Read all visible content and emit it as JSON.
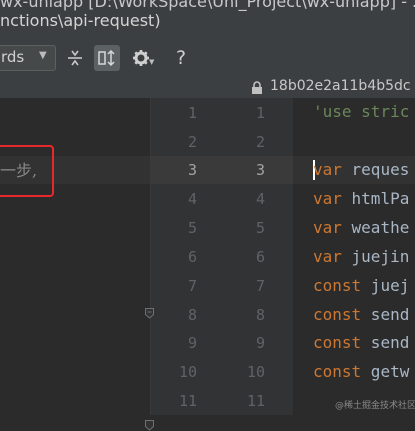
{
  "window": {
    "title_partial": "wx-uniapp [D:\\WorkSpace\\Uni_Project\\wx-uniapp] - ...\\uni",
    "path_title": "nctions\\api-request)"
  },
  "toolbar": {
    "dropdown_value": "rds",
    "buttons": [
      "collapse-unchanged",
      "side-by-side-viewer",
      "settings",
      "help"
    ],
    "help_label": "?"
  },
  "infobar": {
    "revision_hash": "18b02e2a11b4b5dc"
  },
  "left_pane": {
    "highlighted_text": "一步,"
  },
  "gutter": {
    "left_numbers": [
      "1",
      "2",
      "3",
      "4",
      "5",
      "6",
      "7",
      "8",
      "9",
      "10",
      "11"
    ],
    "right_numbers": [
      "1",
      "2",
      "3",
      "4",
      "5",
      "6",
      "7",
      "8",
      "9",
      "10",
      "11"
    ],
    "current_line": "3"
  },
  "editor": {
    "lines": [
      {
        "kw": "",
        "rest": "",
        "str": "'use stric"
      },
      {
        "kw": "",
        "rest": "",
        "str": ""
      },
      {
        "kw": "var",
        "rest": " reques",
        "str": ""
      },
      {
        "kw": "var",
        "rest": " htmlPa",
        "str": ""
      },
      {
        "kw": "var",
        "rest": " weathe",
        "str": ""
      },
      {
        "kw": "var",
        "rest": " juejin",
        "str": ""
      },
      {
        "kw": "const",
        "rest": " juej",
        "str": ""
      },
      {
        "kw": "const",
        "rest": " send",
        "str": ""
      },
      {
        "kw": "const",
        "rest": " send",
        "str": ""
      },
      {
        "kw": "const",
        "rest": " getw",
        "str": ""
      },
      {
        "kw": "",
        "rest": "",
        "str": ""
      }
    ]
  },
  "watermark": "@稀土掘金技术社区",
  "colors": {
    "keyword": "#cc7832",
    "string": "#6a8759",
    "highlight_box": "#e8292b",
    "background": "#2b2b2b"
  }
}
